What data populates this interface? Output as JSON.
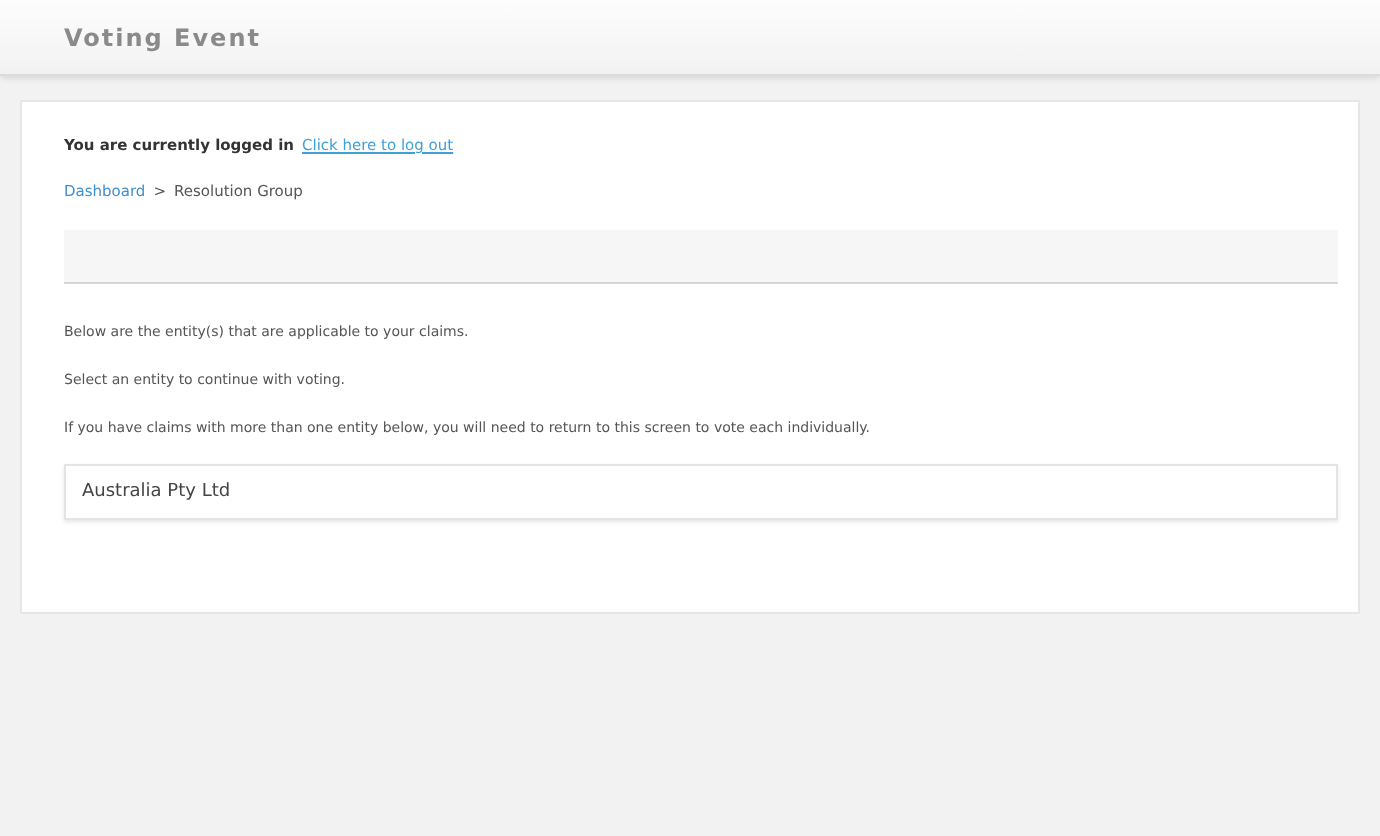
{
  "header": {
    "title": "Voting Event"
  },
  "login": {
    "text": "You are currently logged in",
    "link": "Click here to log out"
  },
  "breadcrumb": {
    "items": [
      "Dashboard",
      "Resolution Group"
    ],
    "separator": ">"
  },
  "paragraphs": [
    "Below are the entity(s) that are applicable to your claims.",
    "Select an entity to continue with voting.",
    "If you have claims with more than one entity below, you will need to return to this screen to vote each individually."
  ],
  "entities": [
    "Australia Pty Ltd"
  ]
}
